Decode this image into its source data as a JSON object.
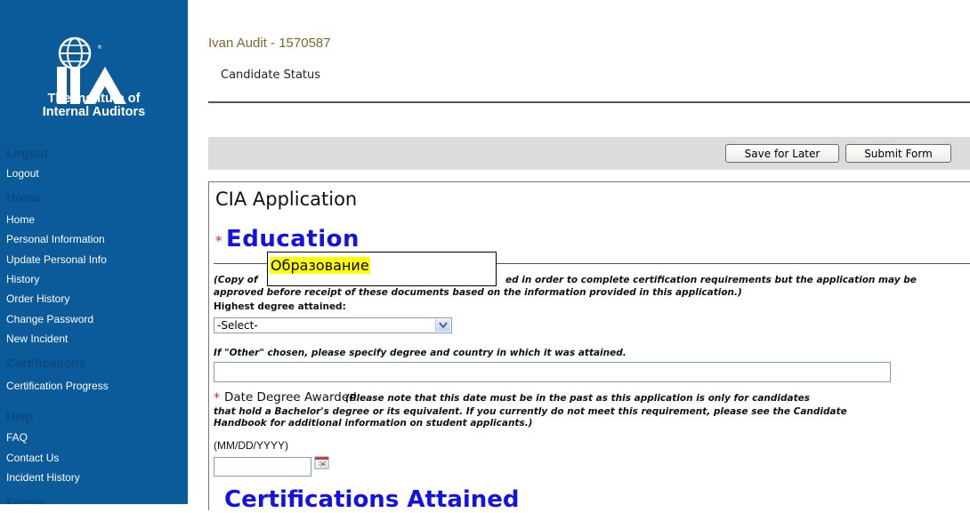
{
  "sidebar": {
    "logo_text_line1": "The Institute of",
    "logo_text_line2": "Internal Auditors",
    "logo_mark": "IIA",
    "sections": [
      {
        "heading": "Logout",
        "items": [
          "Logout"
        ]
      },
      {
        "heading": "Home",
        "items": [
          "Home",
          "Personal Information",
          "Update Personal Info",
          "History",
          "Order History",
          "Change Password",
          "New Incident"
        ]
      },
      {
        "heading": "Certifications",
        "items": [
          "Certification Progress"
        ]
      },
      {
        "heading": "Help",
        "items": [
          "FAQ",
          "Contact Us",
          "Incident History"
        ]
      },
      {
        "heading": "Forms",
        "items": []
      }
    ]
  },
  "header": {
    "candidate_name": "Ivan Audit - 1570587",
    "status_link": "Candidate Status"
  },
  "toolbar": {
    "save_label": "Save for Later",
    "submit_label": "Submit Form"
  },
  "form": {
    "title": "CIA Application",
    "education": {
      "required_mark": "*",
      "heading": "Education",
      "tooltip_text": "Образование",
      "note_line1_left": "(Copy of",
      "note_line1_right": "ed in order to complete certification requirements but the application may be",
      "note_line2": "approved before receipt of these documents based on the information provided in this application.)",
      "degree_label": "Highest degree attained:",
      "degree_selected": "-Select-",
      "other_label": "If \"Other\" chosen, please specify degree and country in which it was attained.",
      "other_value": ""
    },
    "date_awarded": {
      "required_mark": "*",
      "label": "Date Degree Awarded",
      "note_line1": "(Please note that this date must be in the past as this application is only for candidates",
      "note_line2": "that hold a Bachelor's degree or its equivalent. If you currently do not meet this requirement, please see the Candidate",
      "note_line3": "Handbook for additional information on student applicants.)",
      "format_hint": "(MM/DD/YYYY)",
      "value": ""
    },
    "certifications_heading": "Certifications Attained"
  },
  "colors": {
    "sidebar_bg": "#0b5a9a",
    "sidebar_heading": "#0a4a82",
    "heading_blue": "#1212e8",
    "required_red": "#e0262c",
    "candidate_name": "#7a6a2a",
    "tooltip_highlight": "#ffff00"
  },
  "icons": {
    "logo": "iia-globe-logo-icon",
    "select_arrow": "chevron-down-icon",
    "calendar": "calendar-icon"
  }
}
